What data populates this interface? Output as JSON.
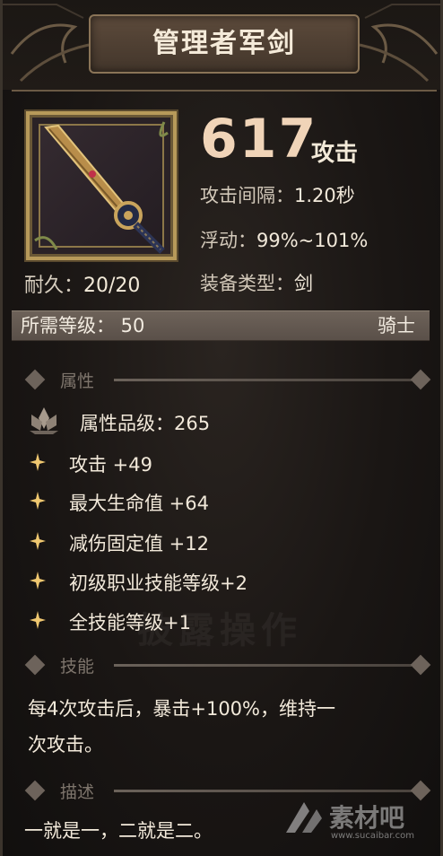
{
  "item": {
    "name": "管理者军剑",
    "attack_value": "617",
    "attack_unit": "攻击",
    "attack_interval": {
      "label": "攻击间隔：",
      "value": "1.20秒"
    },
    "float": {
      "label": "浮动：",
      "value": "99%~101%"
    },
    "equip_type": {
      "label": "装备类型：",
      "value": "剑"
    },
    "durability": {
      "label": "耐久：",
      "value": "20/20"
    }
  },
  "requirement": {
    "label": "所需等级：  50",
    "class": "骑士"
  },
  "sections": {
    "attributes": "属性",
    "skill": "技能",
    "description": "描述"
  },
  "attribute_grade": "属性品级：265",
  "attributes": [
    "攻击 +49",
    "最大生命值 +64",
    "减伤固定值 +12",
    "初级职业技能等级+2",
    "全技能等级+1"
  ],
  "skill_text_line1": "每4次攻击后，暴击+100%，维持一",
  "skill_text_line2": "次攻击。",
  "description_text": "一就是一，二就是二。",
  "background_text": "披露操作",
  "watermark": {
    "brand": "素材吧",
    "url": "www.sucaibar.com"
  }
}
